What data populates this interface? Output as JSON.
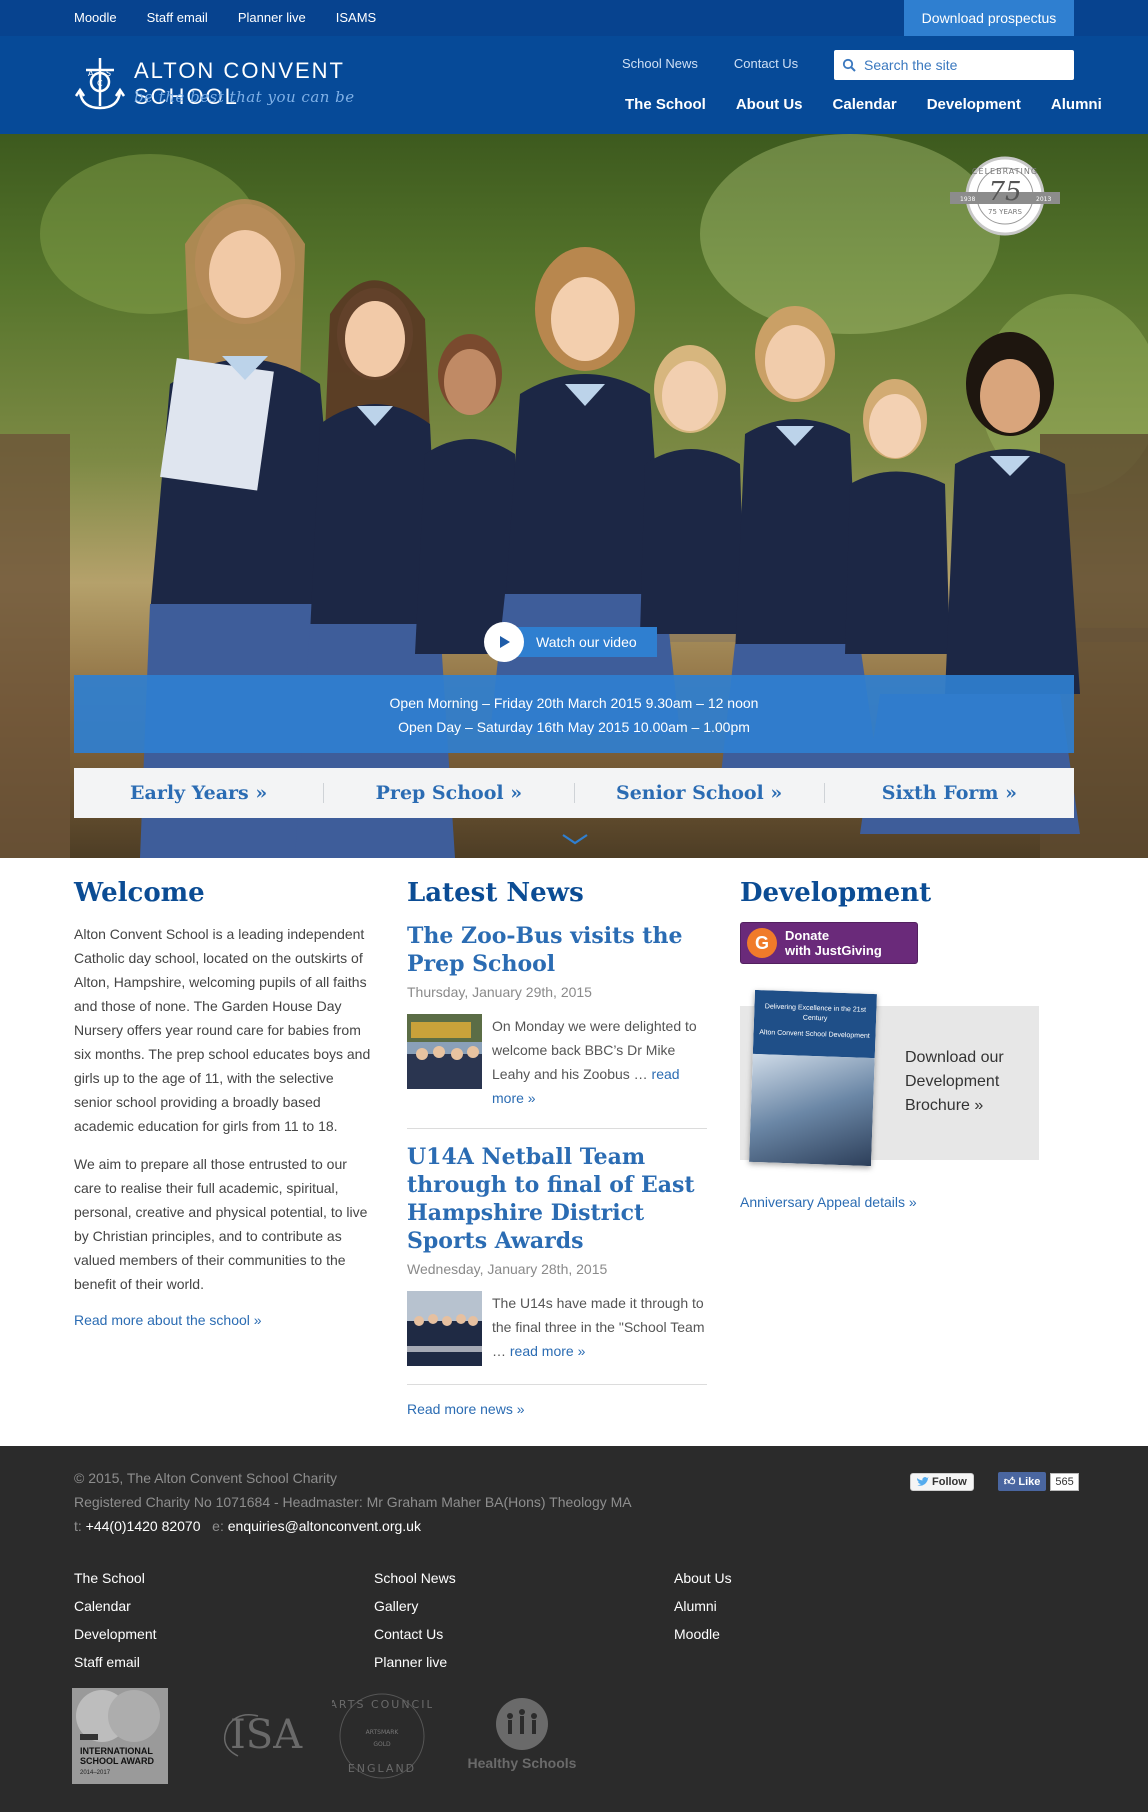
{
  "topbar": {
    "links": [
      "Moodle",
      "Staff email",
      "Planner live",
      "ISAMS"
    ],
    "prospectus_label": "Download prospectus"
  },
  "header": {
    "school_name": "ALTON CONVENT SCHOOL",
    "motto": "be the best that you can be",
    "secondary_links": [
      "School News",
      "Contact Us"
    ],
    "search_placeholder": "Search the site",
    "main_nav": [
      "The School",
      "About Us",
      "Calendar",
      "Development",
      "Alumni"
    ]
  },
  "hero": {
    "badge": {
      "top": "CELEBRATING",
      "number": "75",
      "left_year": "1938",
      "years": "75 YEARS",
      "right_year": "2013"
    },
    "watch_video": "Watch our video",
    "open_events": [
      "Open Morning – Friday 20th March 2015 9.30am – 12 noon",
      "Open Day – Saturday 16th May 2015 10.00am – 1.00pm"
    ],
    "school_sections": [
      "Early Years »",
      "Prep School »",
      "Senior School »",
      "Sixth Form »"
    ]
  },
  "welcome": {
    "heading": "Welcome",
    "para1": "Alton Convent School is a leading independent Catholic day school, located on the outskirts of Alton, Hampshire, welcoming pupils of all faiths and those of none. The Garden House Day Nursery offers year round care for babies from six months. The prep school educates boys and girls up to the age of 11, with the selective senior school providing a broadly based academic education for girls from 11 to 18.",
    "para2": "We aim to prepare all those entrusted to our care to realise their full academic, spiritual, personal, creative and physical potential, to live by Christian principles, and to contribute as valued members of their communities to the benefit of their world.",
    "more_link": "Read more about the school »"
  },
  "news": {
    "heading": "Latest News",
    "items": [
      {
        "title": "The Zoo-Bus visits the Prep School",
        "date": "Thursday, January 29th, 2015",
        "excerpt": " On Monday we were delighted to welcome back BBC’s Dr Mike Leahy and his Zoobus … ",
        "read_more": "read more »"
      },
      {
        "title": "U14A Netball Team through to final of East Hampshire District Sports Awards",
        "date": "Wednesday, January 28th, 2015",
        "excerpt": "The U14s have made it through to the final three in the \"School Team … ",
        "read_more": "read more »"
      }
    ],
    "more_link": "Read more news »"
  },
  "development": {
    "heading": "Development",
    "donate_line1": "Donate",
    "donate_line2": "with JustGiving",
    "brochure_cover_title": "Delivering Excellence in the 21st Century",
    "brochure_cover_sub": "Alton Convent School Development",
    "brochure_text": "Download our Development Brochure »",
    "appeal_link": "Anniversary Appeal details »"
  },
  "footer": {
    "copyright": "© 2015, The Alton Convent School Charity",
    "charity": "Registered Charity No 1071684 - Headmaster: Mr Graham Maher BA(Hons) Theology MA",
    "tel_prefix": "t:",
    "tel": "+44(0)1420 82070",
    "email_prefix": "e:",
    "email": "enquiries@altonconvent.org.uk",
    "twitter": "Follow",
    "facebook": "Like",
    "facebook_count": "565",
    "link_columns": [
      [
        "The School",
        "Calendar",
        "Development",
        "Staff email"
      ],
      [
        "School News",
        "Gallery",
        "Contact Us",
        "Planner live"
      ],
      [
        "About Us",
        "Alumni",
        "Moodle"
      ]
    ],
    "logos": {
      "intl_award_l1": "INTERNATIONAL",
      "intl_award_l2": "SCHOOL AWARD",
      "intl_award_years": "2014–2017",
      "isa": "ISA",
      "arts_top": "ARTS COUNCIL",
      "arts_mid": "ARTSMARK",
      "arts_gold": "GOLD",
      "arts_bottom": "ENGLAND",
      "healthy": "Healthy Schools"
    }
  }
}
